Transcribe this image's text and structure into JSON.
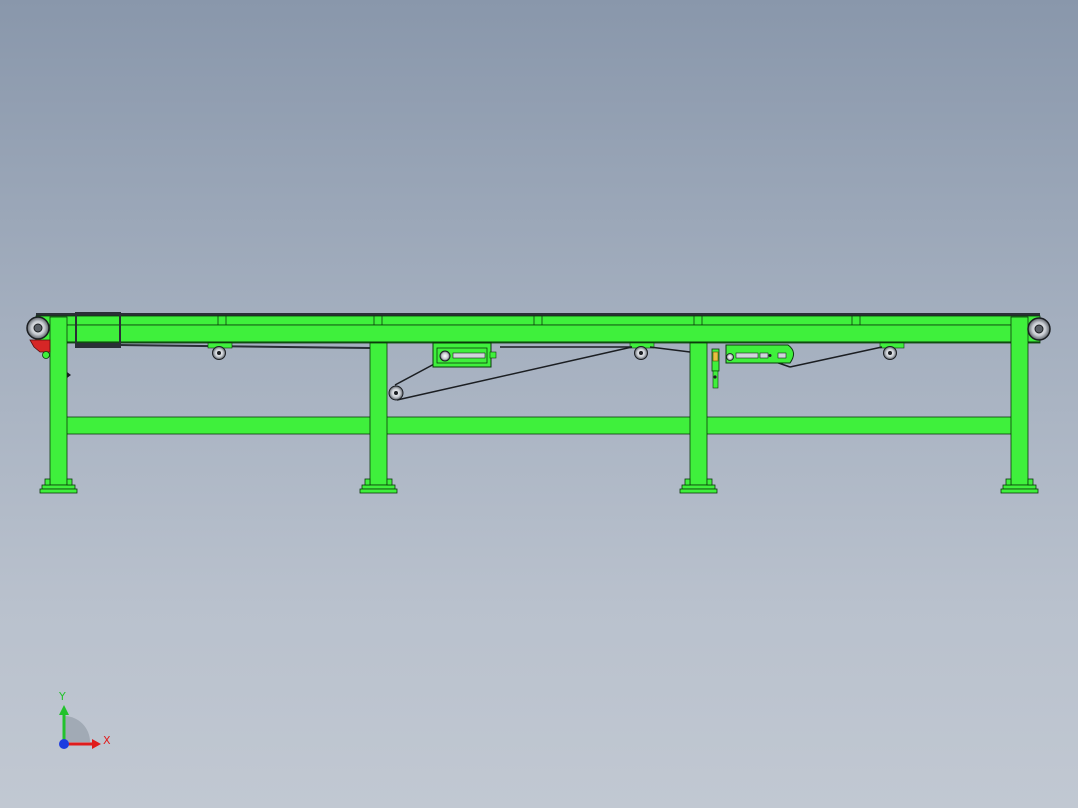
{
  "view": {
    "colors": {
      "frame": "#3ff03c",
      "frame_edge": "#0a3a0a",
      "belt": "#2a2f36",
      "roller": "#dfe3e8",
      "motor_red": "#d62626",
      "accent_yellow": "#e8c040",
      "axis_x": "#e01c1c",
      "axis_y": "#22c22c",
      "axis_z": "#1c3be0"
    }
  },
  "triad": {
    "x_label": "X",
    "y_label": "Y"
  }
}
